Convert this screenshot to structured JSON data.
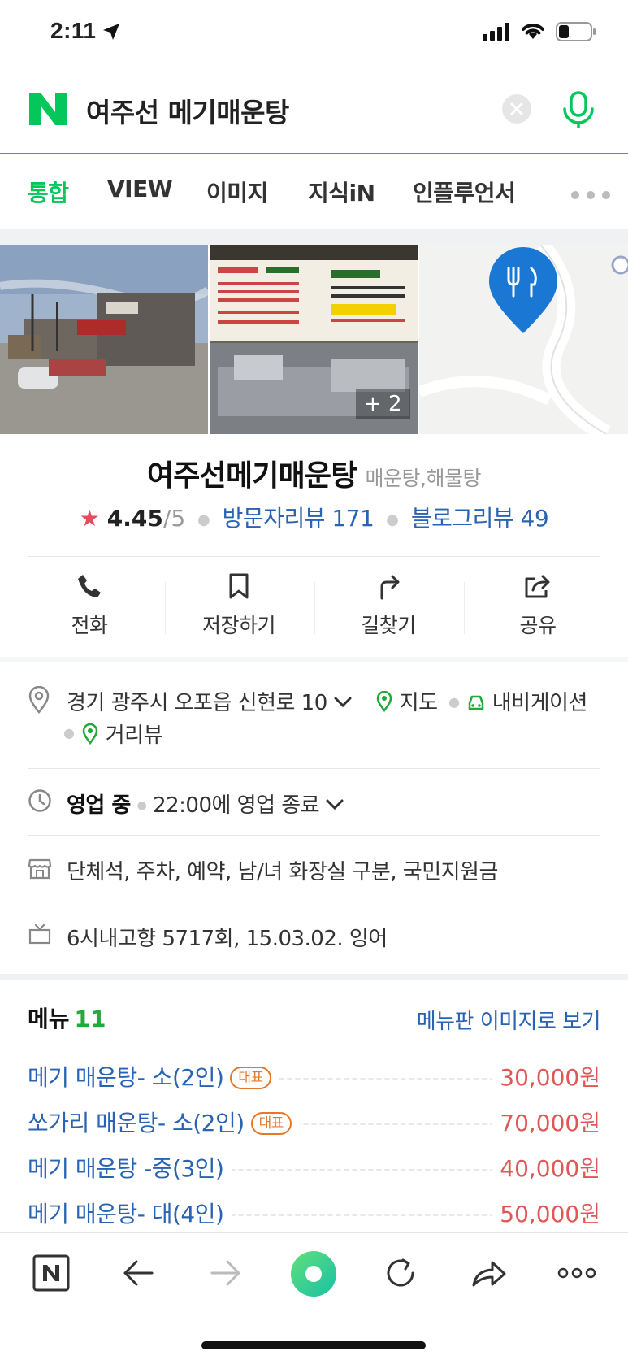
{
  "status_bar": {
    "time": "2:11"
  },
  "search": {
    "query": "여주선 메기매운탕"
  },
  "tabs": [
    {
      "label": "통합",
      "active": true
    },
    {
      "label": "VIEW",
      "active": false
    },
    {
      "label": "이미지",
      "active": false
    },
    {
      "label": "지식iN",
      "active": false
    },
    {
      "label": "인플루언서",
      "active": false
    }
  ],
  "photos": {
    "more_count": "+ 2"
  },
  "place": {
    "name": "여주선메기매운탕",
    "category": "매운탕,해물탕",
    "rating": "4.45",
    "rating_max": "/5",
    "visitor_reviews": "방문자리뷰 171",
    "blog_reviews": "블로그리뷰 49"
  },
  "actions": [
    {
      "label": "전화",
      "icon": "phone-icon"
    },
    {
      "label": "저장하기",
      "icon": "bookmark-icon"
    },
    {
      "label": "길찾기",
      "icon": "directions-icon"
    },
    {
      "label": "공유",
      "icon": "share-icon"
    }
  ],
  "info": {
    "address": "경기 광주시 오포읍 신현로 10",
    "map_link": "지도",
    "navigation_link": "내비게이션",
    "streetview_link": "거리뷰",
    "status": "영업 중",
    "hours": "22:00에 영업 종료",
    "amenities": "단체석, 주차, 예약, 남/녀 화장실 구분, 국민지원금",
    "tv": "6시내고향 5717회, 15.03.02. 잉어"
  },
  "menu": {
    "title": "메뉴",
    "count": "11",
    "image_link": "메뉴판 이미지로 보기",
    "items": [
      {
        "name": "메기 매운탕- 소(2인)",
        "badge": "대표",
        "price": "30,000원"
      },
      {
        "name": "쏘가리 매운탕- 소(2인)",
        "badge": "대표",
        "price": "70,000원"
      },
      {
        "name": "메기 매운탕 -중(3인)",
        "badge": "",
        "price": "40,000원"
      },
      {
        "name": "메기 매운탕- 대(4인)",
        "badge": "",
        "price": "50,000원"
      }
    ]
  },
  "colors": {
    "naver_green": "#03c75a",
    "link_blue": "#2a63b4",
    "price_red": "#e05757",
    "badge_orange": "#e3782a"
  }
}
